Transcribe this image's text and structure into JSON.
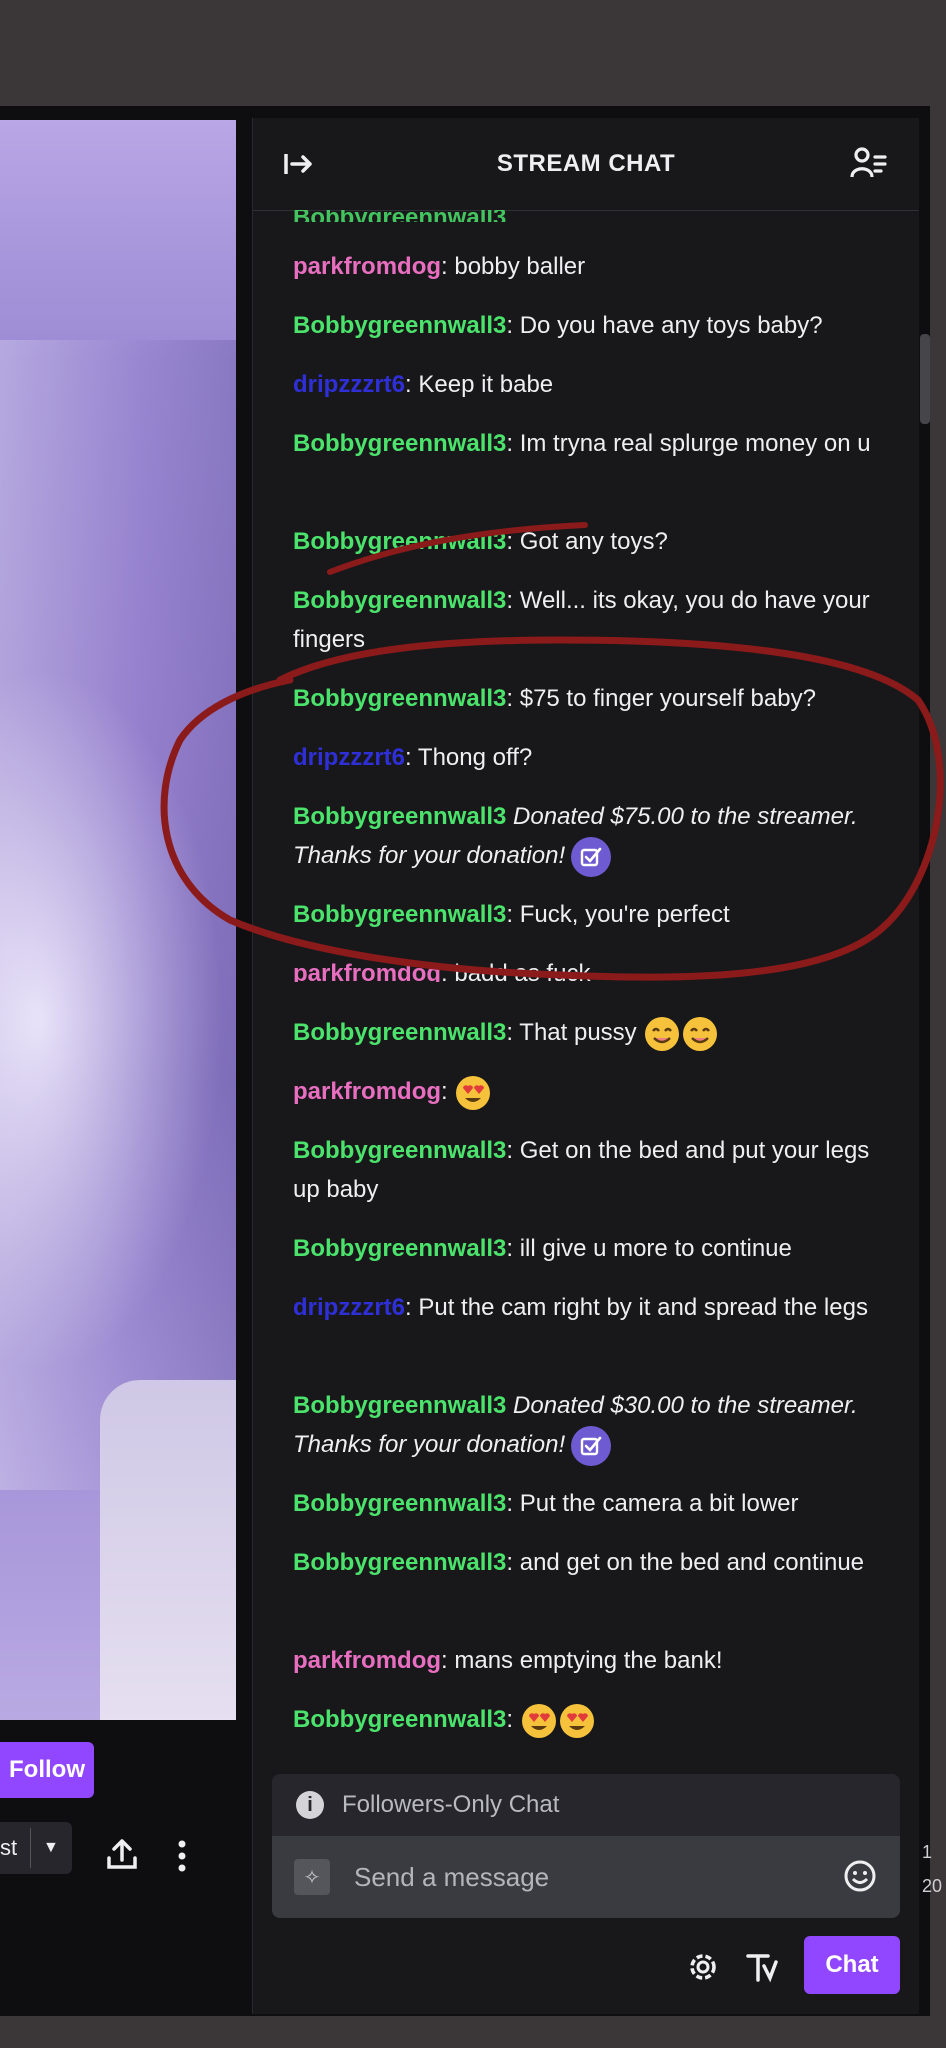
{
  "chat": {
    "title": "STREAM CHAT",
    "collapse_icon": "collapse-arrow-icon",
    "users_icon": "community-icon",
    "messages": [
      {
        "user": "parkfromdog",
        "color": "#e86ec0",
        "sep": ": ",
        "text": "bobby baller"
      },
      {
        "user": "Bobbygreennwall3",
        "color": "#4be36b",
        "sep": ": ",
        "text": "Do you have any toys baby?"
      },
      {
        "user": "dripzzzrt6",
        "color": "#2f2fd8",
        "sep": ": ",
        "text": "Keep it babe"
      },
      {
        "user": "Bobbygreennwall3",
        "color": "#4be36b",
        "sep": ": ",
        "text": "Im tryna real splurge money on u"
      },
      {
        "user": "Bobbygreennwall3",
        "color": "#4be36b",
        "sep": ": ",
        "text": "Got any toys?"
      },
      {
        "user": "Bobbygreennwall3",
        "color": "#4be36b",
        "sep": ": ",
        "text": "Well... its okay, you do have your fingers"
      },
      {
        "user": "Bobbygreennwall3",
        "color": "#4be36b",
        "sep": ": ",
        "text": "$75 to finger yourself baby?"
      },
      {
        "user": "dripzzzrt6",
        "color": "#2f2fd8",
        "sep": ": ",
        "text": "Thong off?"
      },
      {
        "user": "Bobbygreennwall3",
        "color": "#4be36b",
        "sep": " ",
        "text": "Donated $75.00 to the streamer. Thanks for your donation!"
      },
      {
        "user": "Bobbygreennwall3",
        "color": "#4be36b",
        "sep": ": ",
        "text": "Fuck, you're perfect"
      },
      {
        "user": "parkfromdog",
        "color": "#e86ec0",
        "sep": ": ",
        "text": "badd as fuck"
      },
      {
        "user": "Bobbygreennwall3",
        "color": "#4be36b",
        "sep": ": ",
        "text": "That pussy"
      },
      {
        "user": "parkfromdog",
        "color": "#e86ec0",
        "sep": ": ",
        "text": ""
      },
      {
        "user": "Bobbygreennwall3",
        "color": "#4be36b",
        "sep": ": ",
        "text": "Get on the bed and put your legs up baby"
      },
      {
        "user": "Bobbygreennwall3",
        "color": "#4be36b",
        "sep": ": ",
        "text": "ill give u more to continue"
      },
      {
        "user": "dripzzzrt6",
        "color": "#2f2fd8",
        "sep": ": ",
        "text": "Put the cam right by it and spread the legs"
      },
      {
        "user": "Bobbygreennwall3",
        "color": "#4be36b",
        "sep": " ",
        "text": "Donated $30.00 to the streamer. Thanks for your donation!"
      },
      {
        "user": "Bobbygreennwall3",
        "color": "#4be36b",
        "sep": ": ",
        "text": "Put the camera a bit lower"
      },
      {
        "user": "Bobbygreennwall3",
        "color": "#4be36b",
        "sep": ": ",
        "text": "and get on the bed and continue"
      },
      {
        "user": "parkfromdog",
        "color": "#e86ec0",
        "sep": ": ",
        "text": "mans emptying the bank!"
      },
      {
        "user": "Bobbygreennwall3",
        "color": "#4be36b",
        "sep": ": ",
        "text": ""
      }
    ],
    "followers_only_label": "Followers-Only Chat",
    "input_placeholder": "Send a message",
    "chat_button": "Chat"
  },
  "player": {
    "follow_button": "Follow",
    "split_button_text": "st"
  },
  "edge": {
    "line1": "1",
    "line2": "20"
  },
  "annotation_color": "#8b1a1a"
}
